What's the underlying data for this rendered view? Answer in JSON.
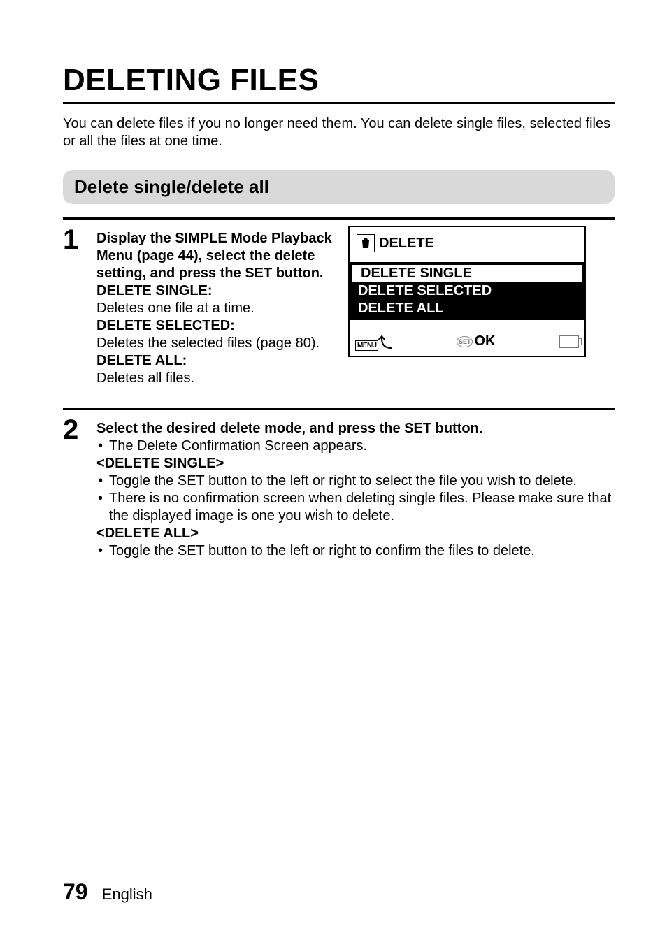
{
  "title": "DELETING FILES",
  "intro": "You can delete files if you no longer need them. You can delete single files, selected files or all the files at one time.",
  "subheading": "Delete single/delete all",
  "step1": {
    "instruction": "Display the SIMPLE Mode Playback Menu (page 44), select the delete setting, and press the SET button.",
    "opt_single_label": "DELETE SINGLE:",
    "opt_single_desc": "Deletes one file at a time.",
    "opt_selected_label": "DELETE SELECTED:",
    "opt_selected_desc": "Deletes the selected files (page 80).",
    "opt_all_label": "DELETE ALL:",
    "opt_all_desc": "Deletes all files."
  },
  "screen": {
    "title": "DELETE",
    "items": [
      "DELETE SINGLE",
      "DELETE SELECTED",
      "DELETE ALL"
    ],
    "menu_label": "MENU",
    "set_label": "SET",
    "ok_label": "OK"
  },
  "step2": {
    "instruction": "Select the desired delete mode, and press the SET button.",
    "line1": "The Delete Confirmation Screen appears.",
    "single_head": "<DELETE SINGLE>",
    "single_b1": "Toggle the SET button to the left or right to select the file you wish to delete.",
    "single_b2": "There is no confirmation screen when deleting single files. Please make sure that the displayed image is one you wish to delete.",
    "all_head": "<DELETE ALL>",
    "all_b1": "Toggle the SET button to the left or right to confirm the files to delete."
  },
  "footer": {
    "page": "79",
    "lang": "English"
  }
}
